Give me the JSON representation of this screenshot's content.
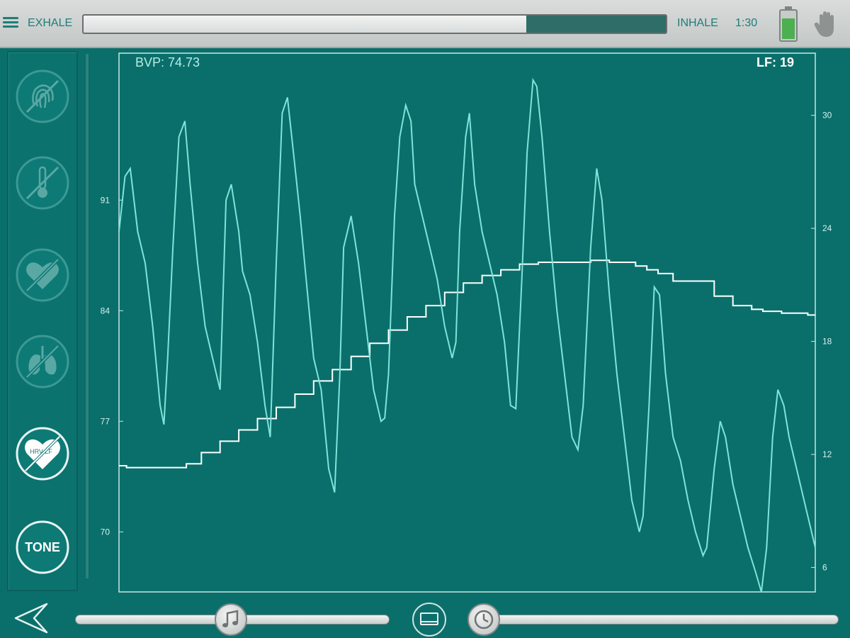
{
  "header": {
    "exhale_label": "EXHALE",
    "inhale_label": "INHALE",
    "timer": "1:30",
    "breath_progress": 0.76
  },
  "readouts": {
    "bvp": "BVP: 74.73",
    "lf": "LF: 19"
  },
  "sidebar": {
    "buttons": [
      {
        "name": "skin-conductance-disabled",
        "icon": "fingerprint-slash-icon"
      },
      {
        "name": "temperature-disabled",
        "icon": "thermometer-slash-icon"
      },
      {
        "name": "heart-disabled",
        "icon": "heart-slash-icon"
      },
      {
        "name": "respiration-disabled",
        "icon": "lungs-slash-icon"
      },
      {
        "name": "hrv-lf-disabled",
        "icon": "heart-hrv-lf-slash-icon",
        "label": "HRV LF"
      },
      {
        "name": "tone",
        "label": "TONE"
      }
    ]
  },
  "colors": {
    "background": "#0a6f6b",
    "bvp_line": "#7fe3da",
    "lf_line": "#ffffff",
    "accent": "#1f7d78",
    "battery": "#4caf50"
  },
  "chart_data": {
    "type": "line",
    "left_axis": {
      "ticks": [
        70,
        77,
        84,
        91
      ],
      "range": [
        66.2,
        100.3
      ]
    },
    "right_axis": {
      "ticks": [
        6,
        12,
        18,
        24,
        30
      ],
      "range": [
        4.7,
        33.3
      ]
    },
    "series": [
      {
        "axis": "left",
        "points": [
          [
            0,
            89
          ],
          [
            0.8,
            92.5
          ],
          [
            1.5,
            93
          ],
          [
            2.5,
            89
          ],
          [
            3.5,
            87
          ],
          [
            4.5,
            83
          ],
          [
            5.5,
            78
          ],
          [
            6.0,
            76.8
          ],
          [
            6.5,
            81
          ],
          [
            7.2,
            88
          ],
          [
            8,
            95
          ],
          [
            8.8,
            96
          ],
          [
            9.5,
            92
          ],
          [
            10.5,
            87
          ],
          [
            11.5,
            83
          ],
          [
            12.5,
            81
          ],
          [
            13.5,
            79
          ],
          [
            14.3,
            91
          ],
          [
            15,
            92
          ],
          [
            16,
            89
          ],
          [
            16.5,
            86.5
          ],
          [
            17.5,
            85
          ],
          [
            18.5,
            82
          ],
          [
            19.5,
            78
          ],
          [
            20.2,
            76
          ],
          [
            21,
            87
          ],
          [
            21.8,
            96.5
          ],
          [
            22.5,
            97.5
          ],
          [
            23.3,
            94
          ],
          [
            24.2,
            90
          ],
          [
            25,
            86
          ],
          [
            26,
            81
          ],
          [
            27,
            79
          ],
          [
            28,
            74
          ],
          [
            28.8,
            72.5
          ],
          [
            29.5,
            80
          ],
          [
            30,
            88
          ],
          [
            31,
            90
          ],
          [
            32,
            87
          ],
          [
            33,
            83
          ],
          [
            34,
            79
          ],
          [
            35,
            77
          ],
          [
            35.5,
            77.2
          ],
          [
            36,
            80
          ],
          [
            36.8,
            90
          ],
          [
            37.5,
            95
          ],
          [
            38.3,
            97
          ],
          [
            39,
            96
          ],
          [
            39.5,
            92
          ],
          [
            40.5,
            90
          ],
          [
            41.5,
            88
          ],
          [
            42.5,
            86
          ],
          [
            43.5,
            83
          ],
          [
            44.5,
            81
          ],
          [
            45,
            82
          ],
          [
            45.5,
            89
          ],
          [
            46.3,
            95
          ],
          [
            46.8,
            96.5
          ],
          [
            47.5,
            92
          ],
          [
            48.5,
            89
          ],
          [
            49.5,
            87
          ],
          [
            50.5,
            85
          ],
          [
            51.5,
            82
          ],
          [
            52.3,
            78
          ],
          [
            53.0,
            77.8
          ],
          [
            53.8,
            86
          ],
          [
            54.5,
            94
          ],
          [
            55.3,
            98.6
          ],
          [
            55.8,
            98.2
          ],
          [
            56.5,
            95
          ],
          [
            57.5,
            89
          ],
          [
            58.5,
            84
          ],
          [
            59.5,
            80
          ],
          [
            60.5,
            76
          ],
          [
            61.3,
            75.2
          ],
          [
            62,
            78
          ],
          [
            63,
            88
          ],
          [
            63.8,
            93
          ],
          [
            64.5,
            91
          ],
          [
            65.5,
            85
          ],
          [
            66.5,
            80
          ],
          [
            67.5,
            76
          ],
          [
            68.5,
            72
          ],
          [
            69.5,
            70
          ],
          [
            70,
            71
          ],
          [
            70.8,
            78
          ],
          [
            71.5,
            85.5
          ],
          [
            72.2,
            85
          ],
          [
            73,
            80
          ],
          [
            74,
            76
          ],
          [
            75,
            74.5
          ],
          [
            76,
            72
          ],
          [
            77,
            70
          ],
          [
            78,
            68.5
          ],
          [
            78.5,
            69
          ],
          [
            79.5,
            74
          ],
          [
            80.3,
            77
          ],
          [
            81,
            76
          ],
          [
            82,
            73
          ],
          [
            83,
            71
          ],
          [
            84,
            69
          ],
          [
            85,
            67.5
          ],
          [
            85.8,
            66.2
          ],
          [
            86.5,
            69
          ],
          [
            87.3,
            76
          ],
          [
            88,
            79
          ],
          [
            88.8,
            78
          ],
          [
            89.5,
            76
          ],
          [
            90.5,
            74
          ],
          [
            91.5,
            72
          ],
          [
            92.5,
            70
          ],
          [
            93,
            69
          ]
        ]
      },
      {
        "axis": "right",
        "type": "step",
        "points": [
          [
            0,
            11.4
          ],
          [
            1,
            11.3
          ],
          [
            6,
            11.3
          ],
          [
            9,
            11.5
          ],
          [
            11,
            12.1
          ],
          [
            13.5,
            12.7
          ],
          [
            16,
            13.3
          ],
          [
            18.5,
            13.9
          ],
          [
            21,
            14.5
          ],
          [
            23.5,
            15.2
          ],
          [
            26,
            15.9
          ],
          [
            28.5,
            16.5
          ],
          [
            31,
            17.2
          ],
          [
            33.5,
            17.9
          ],
          [
            36,
            18.6
          ],
          [
            38.5,
            19.3
          ],
          [
            41,
            19.9
          ],
          [
            43.5,
            20.6
          ],
          [
            46,
            21.1
          ],
          [
            48.5,
            21.5
          ],
          [
            51,
            21.8
          ],
          [
            53.5,
            22.1
          ],
          [
            56,
            22.2
          ],
          [
            63,
            22.3
          ],
          [
            65.5,
            22.2
          ],
          [
            69,
            22.0
          ],
          [
            70.5,
            21.8
          ],
          [
            72,
            21.6
          ],
          [
            74,
            21.2
          ],
          [
            79.5,
            20.4
          ],
          [
            82,
            19.9
          ],
          [
            84.5,
            19.7
          ],
          [
            86,
            19.6
          ],
          [
            88.5,
            19.5
          ],
          [
            92,
            19.4
          ],
          [
            93,
            19.4
          ]
        ]
      }
    ]
  }
}
